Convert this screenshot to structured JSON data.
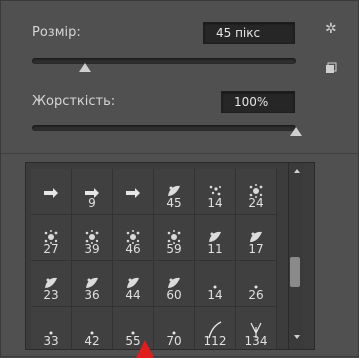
{
  "size": {
    "label": "Розмір:",
    "value": "45 пікс",
    "slider_fraction": 0.2
  },
  "hardness": {
    "label": "Жорсткість:",
    "value": "100%",
    "slider_fraction": 1.0
  },
  "icons": {
    "settings": "gear-icon",
    "new_preset": "new-preset-icon"
  },
  "brushes": [
    {
      "num": "",
      "shape": "arrow"
    },
    {
      "num": "9",
      "shape": "arrow"
    },
    {
      "num": "",
      "shape": "arrow"
    },
    {
      "num": "45",
      "shape": "leaf"
    },
    {
      "num": "14",
      "shape": "scatter"
    },
    {
      "num": "24",
      "shape": "splat"
    },
    {
      "num": "27",
      "shape": "splat"
    },
    {
      "num": "39",
      "shape": "splat"
    },
    {
      "num": "46",
      "shape": "splat"
    },
    {
      "num": "59",
      "shape": "splat"
    },
    {
      "num": "11",
      "shape": "leaf"
    },
    {
      "num": "17",
      "shape": "leaf"
    },
    {
      "num": "23",
      "shape": "leaf"
    },
    {
      "num": "36",
      "shape": "leaf"
    },
    {
      "num": "44",
      "shape": "leaf"
    },
    {
      "num": "60",
      "shape": "leaf"
    },
    {
      "num": "14",
      "shape": "dot"
    },
    {
      "num": "26",
      "shape": "dot"
    },
    {
      "num": "33",
      "shape": "dot"
    },
    {
      "num": "42",
      "shape": "dot"
    },
    {
      "num": "55",
      "shape": "dot"
    },
    {
      "num": "70",
      "shape": "dot"
    },
    {
      "num": "112",
      "shape": "stroke"
    },
    {
      "num": "134",
      "shape": "grass"
    }
  ]
}
